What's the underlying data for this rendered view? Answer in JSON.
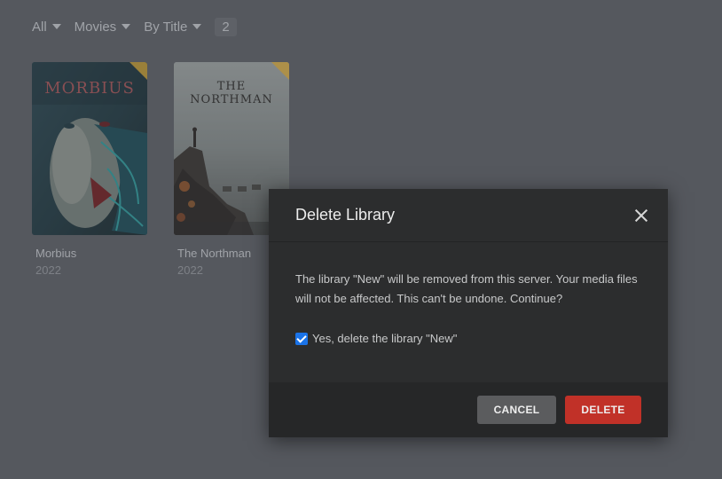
{
  "filters": [
    {
      "label": "All"
    },
    {
      "label": "Movies"
    },
    {
      "label": "By Title"
    }
  ],
  "item_count": "2",
  "movies": [
    {
      "title": "Morbius",
      "year": "2022",
      "poster_text": "MORBIUS"
    },
    {
      "title": "The Northman",
      "year": "2022",
      "poster_text": "THE NORTHMAN"
    }
  ],
  "dialog": {
    "title": "Delete Library",
    "message": "The library \"New\" will be removed from this server. Your media files will not be affected. This can't be undone. Continue?",
    "checkbox_label": "Yes, delete the library \"New\"",
    "checkbox_checked": true,
    "cancel_label": "CANCEL",
    "delete_label": "DELETE"
  },
  "colors": {
    "background": "#55585e",
    "dialog_bg": "#2c2d2e",
    "delete_button": "#c13128",
    "cancel_button": "#5b5c5e",
    "checkbox": "#1a73e8"
  }
}
